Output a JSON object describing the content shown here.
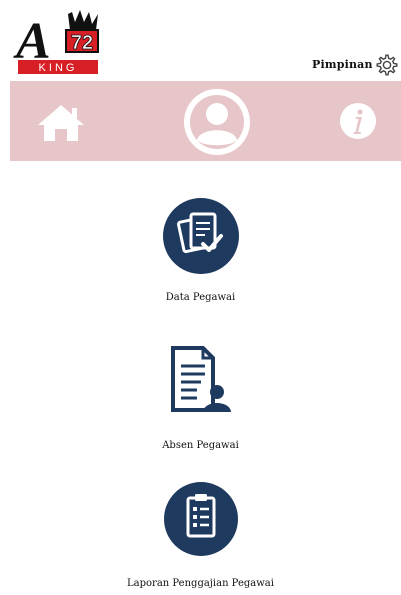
{
  "header": {
    "logo": {
      "brand_letter": "A",
      "brand_number": "72",
      "brand_word": "KING"
    },
    "role_label": "Pimpinan",
    "settings_icon": "gear-icon"
  },
  "nav": {
    "background_color": "#e6c6c8",
    "items": [
      {
        "icon": "home-icon"
      },
      {
        "icon": "user-avatar-icon"
      },
      {
        "icon": "info-icon"
      }
    ]
  },
  "menu": {
    "items": [
      {
        "label": "Data Pegawai",
        "icon": "documents-check-icon"
      },
      {
        "label": "Absen Pegawai",
        "icon": "document-person-icon"
      },
      {
        "label": "Laporan Penggajian Pegawai",
        "icon": "clipboard-list-icon"
      }
    ]
  },
  "colors": {
    "icon_navy": "#1f3a5f",
    "logo_red": "#d81f26",
    "nav_pink": "#e6c6c8"
  }
}
